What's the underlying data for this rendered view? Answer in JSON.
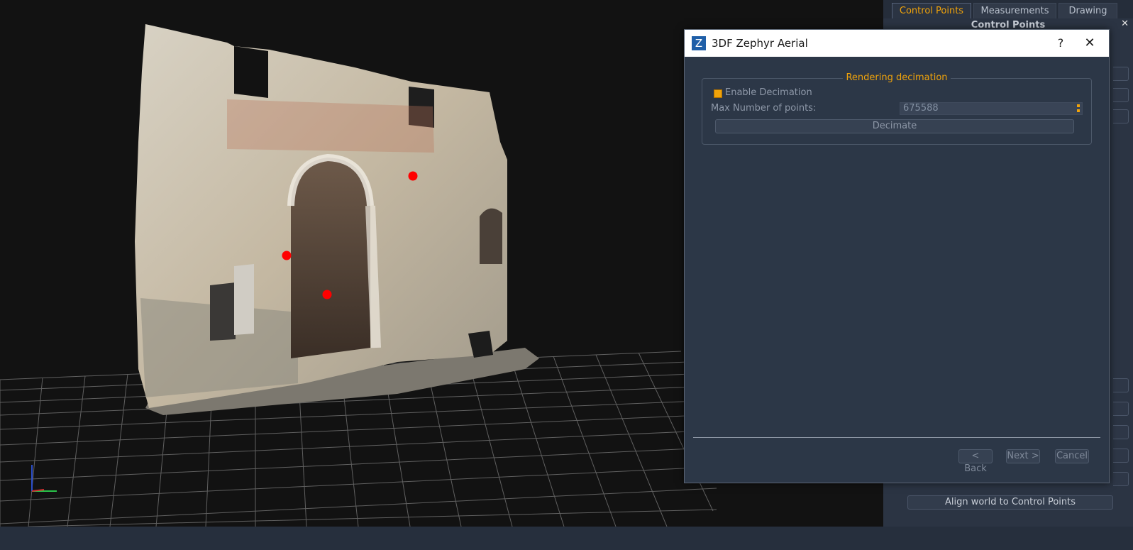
{
  "side_panel": {
    "tabs": [
      {
        "label": "Control Points",
        "active": true
      },
      {
        "label": "Measurements",
        "active": false
      },
      {
        "label": "Drawing",
        "active": false
      }
    ],
    "title": "Control Points",
    "close_glyph": "✕",
    "align_button": "Align world to Control Points"
  },
  "dialog": {
    "icon_letter": "Z",
    "title": "3DF Zephyr Aerial",
    "help_glyph": "?",
    "close_glyph": "✕",
    "group_title": "Rendering decimation",
    "enable_label": "Enable Decimation",
    "enable_checked": true,
    "max_points_label": "Max Number of points:",
    "max_points_value": "675588",
    "decimate_label": "Decimate",
    "back_label": "< Back",
    "next_label": "Next >",
    "cancel_label": "Cancel"
  },
  "colors": {
    "accent": "#f0a30a",
    "panel_bg": "#2c3747",
    "viewport_bg": "#121212",
    "control_point": "#ff0000"
  },
  "viewport": {
    "control_point_count": 3,
    "axis_icon": "axis-gizmo-icon"
  }
}
